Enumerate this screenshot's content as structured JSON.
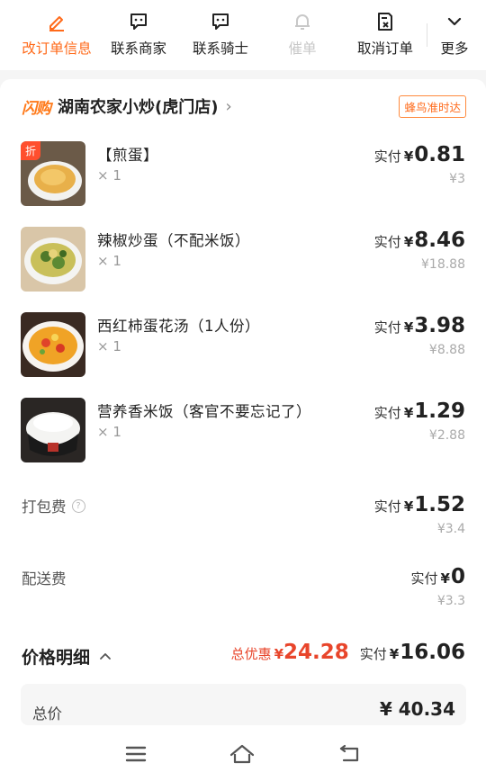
{
  "actions": [
    {
      "label": "改订单信息",
      "icon": "edit-icon"
    },
    {
      "label": "联系商家",
      "icon": "chat-icon"
    },
    {
      "label": "联系骑士",
      "icon": "chat-icon"
    },
    {
      "label": "催单",
      "icon": "bell-icon"
    },
    {
      "label": "取消订单",
      "icon": "cancel-doc-icon"
    },
    {
      "label": "更多",
      "icon": "chevron-down-icon"
    }
  ],
  "store": {
    "badge": "闪购",
    "name": "湖南农家小炒(虎门店)",
    "delivery_tag": "蜂鸟准时达"
  },
  "items": [
    {
      "name": "【煎蛋】",
      "qty": "× 1",
      "paid_label": "实付",
      "currency": "¥",
      "paid": "0.81",
      "original": "¥3",
      "tag": "折"
    },
    {
      "name": "辣椒炒蛋（不配米饭）",
      "qty": "× 1",
      "paid_label": "实付",
      "currency": "¥",
      "paid": "8.46",
      "original": "¥18.88"
    },
    {
      "name": "西红柿蛋花汤（1人份）",
      "qty": "× 1",
      "paid_label": "实付",
      "currency": "¥",
      "paid": "3.98",
      "original": "¥8.88"
    },
    {
      "name": "营养香米饭（客官不要忘记了）",
      "qty": "× 1",
      "paid_label": "实付",
      "currency": "¥",
      "paid": "1.29",
      "original": "¥2.88"
    }
  ],
  "fees": [
    {
      "label": "打包费",
      "paid_label": "实付",
      "currency": "¥",
      "paid": "1.52",
      "original": "¥3.4"
    },
    {
      "label": "配送费",
      "paid_label": "实付",
      "currency": "¥",
      "paid": "0",
      "original": "¥3.3"
    }
  ],
  "price_detail": {
    "title": "价格明细",
    "discount_label": "总优惠",
    "currency": "¥",
    "discount": "24.28",
    "paid_label": "实付",
    "paid": "16.06"
  },
  "total": {
    "label": "总价",
    "value": "¥ 40.34"
  },
  "colors": {
    "accent": "#ff6a1a",
    "discount": "#e8452b"
  }
}
